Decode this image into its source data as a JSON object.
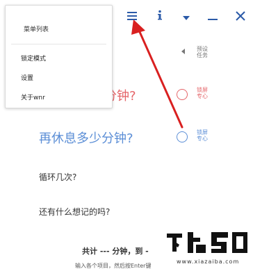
{
  "toolbar": {
    "menu_icon": "hamburger-icon",
    "info_icon": "info-icon",
    "dropdown_icon": "caret-down-icon",
    "minimize_icon": "minimize-icon",
    "close_icon": "close-icon",
    "accent_color": "#2b5aa8"
  },
  "menu": {
    "title": "菜单列表",
    "items": [
      {
        "label": "锁定模式"
      },
      {
        "label": "设置"
      },
      {
        "label": "关于wnr"
      }
    ]
  },
  "preset": {
    "label": "预设任务"
  },
  "work": {
    "question_visible": "分钟?",
    "radio_label": "锁屏专心",
    "color": "#e46468"
  },
  "rest": {
    "question": "再休息多少分钟?",
    "radio_label": "锁屏专心",
    "color": "#5b8ed6"
  },
  "loop": {
    "label": "循环几次?"
  },
  "note": {
    "label": "还有什么想记的吗?"
  },
  "summary": {
    "text": "共计 --- 分钟，到 -"
  },
  "hint": {
    "text": "输入各个项目，然后按Enter键"
  },
  "watermark": {
    "logo": "下载吧",
    "url": "www.xiazaiba.com"
  }
}
